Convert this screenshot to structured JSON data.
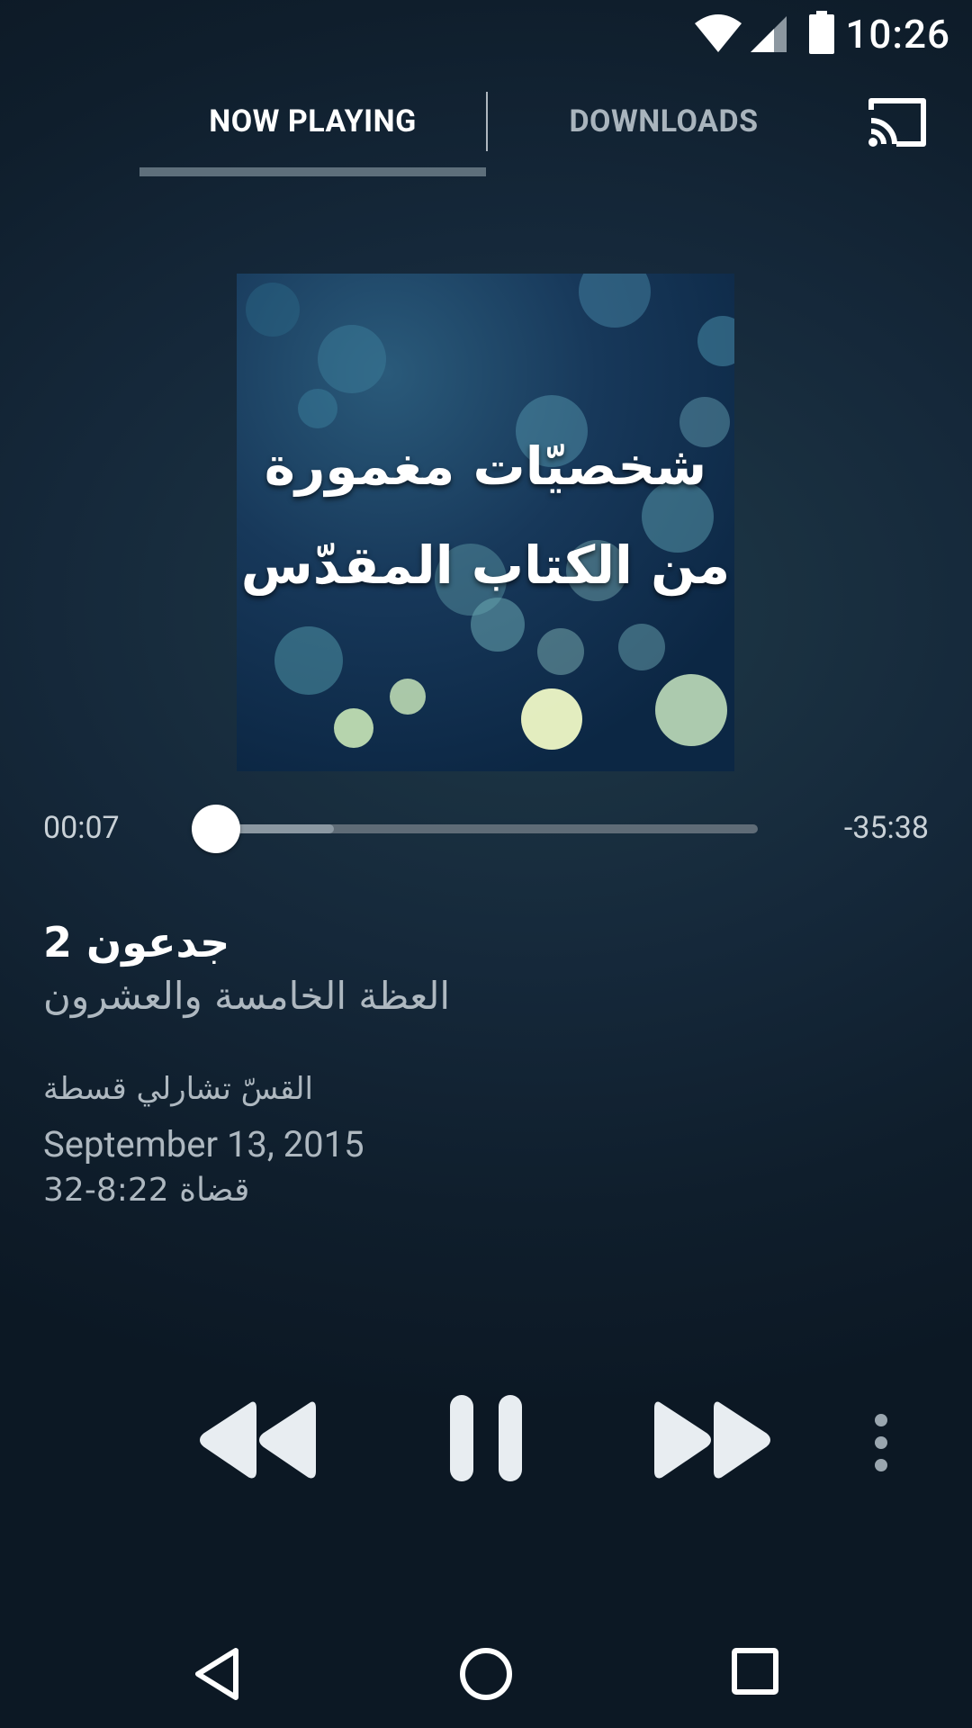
{
  "status_bar": {
    "time": "10:26",
    "icons": [
      "wifi-icon",
      "cell-signal-icon",
      "battery-icon"
    ]
  },
  "tabs": {
    "now_playing": "NOW PLAYING",
    "downloads": "DOWNLOADS",
    "active": "now_playing",
    "cast_icon": "cast-icon"
  },
  "album_art": {
    "line1": "شخصيّات مغمورة",
    "line2": "من الكتاب المقدّس"
  },
  "player": {
    "elapsed": "00:07",
    "remaining": "-35:38",
    "progress_fraction": 0.0033,
    "buffered_fraction": 0.22
  },
  "track": {
    "title": "جدعون 2",
    "subtitle": "العظة الخامسة والعشرون",
    "speaker": "القسّ تشارلي قسطة",
    "date": "September 13, 2015",
    "reference": "قضاة 8:22-32"
  },
  "controls": [
    "rewind-icon",
    "pause-icon",
    "fast-forward-icon",
    "more-vert-icon"
  ],
  "navbar": [
    "back-icon",
    "home-icon",
    "recents-icon"
  ],
  "colors": {
    "background": "#15283a",
    "tab_active": "#ffffff",
    "tab_inactive": "#a9b4bd",
    "tab_indicator": "#5e6f7b",
    "seek_track": "#5f6c77",
    "secondary_text": "#aeb8c0",
    "control_fill": "#e8edf1"
  }
}
